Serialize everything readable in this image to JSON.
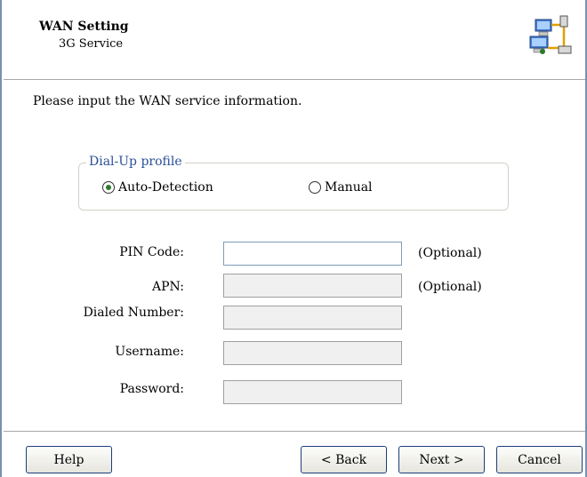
{
  "header": {
    "title": "WAN Setting",
    "subtitle": "3G Service",
    "icon": "network-computers-icon"
  },
  "intro": "Please input the WAN service information.",
  "dialup": {
    "legend": "Dial-Up profile",
    "options": [
      {
        "label": "Auto-Detection",
        "checked": true
      },
      {
        "label": "Manual",
        "checked": false
      }
    ]
  },
  "fields": {
    "pin": {
      "label": "PIN Code:",
      "value": "",
      "note": "(Optional)"
    },
    "apn": {
      "label": "APN:",
      "value": "",
      "note": "(Optional)"
    },
    "dialed": {
      "label": "Dialed Number:",
      "value": ""
    },
    "username": {
      "label": "Username:",
      "value": ""
    },
    "password": {
      "label": "Password:",
      "value": ""
    }
  },
  "buttons": {
    "help": "Help",
    "back": "< Back",
    "next": "Next >",
    "cancel": "Cancel"
  },
  "colors": {
    "legend": "#2a4f9a",
    "border": "#7a8fb0",
    "button_border": "#1c3e7a"
  }
}
